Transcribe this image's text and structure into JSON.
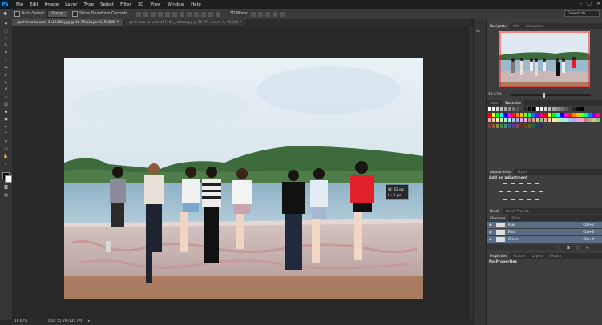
{
  "app": {
    "logo": "Ps"
  },
  "menu": [
    "File",
    "Edit",
    "Image",
    "Layer",
    "Type",
    "Select",
    "Filter",
    "3D",
    "View",
    "Window",
    "Help"
  ],
  "window_controls": [
    "–",
    "▢",
    "✕"
  ],
  "options": {
    "auto_select_label": "Auto-Select:",
    "auto_select_value": "Group",
    "transform_label": "Show Transform Controls",
    "mode_3d_label": "3D Mode:",
    "workspace": "Essentials"
  },
  "tabs": [
    {
      "label": "ganh-hoa-tu-xam-1116300.jpg @ 16.7% (Layer 3, RGB/8) *",
      "active": true
    },
    {
      "label": "ganh-hoa-tu-xam-481181_edited.jpg @ 16.7% (Layer 3, RGB/8) *",
      "active": false
    }
  ],
  "status": {
    "zoom": "16.67%",
    "doc": "Doc: 55.2M/135.7M"
  },
  "transform_readout": {
    "w": "W: 42 px",
    "h": "H: 6 px"
  },
  "navigator": {
    "tabs": [
      "Navigator",
      "Info",
      "Histogram"
    ],
    "zoom": "16.67%"
  },
  "color_panel": {
    "tabs": [
      "Color",
      "Swatches"
    ]
  },
  "adjustments": {
    "tabs": [
      "Adjustments",
      "Styles"
    ],
    "title": "Add an adjustment"
  },
  "brush_tabs": [
    "Brush",
    "Brush Presets"
  ],
  "channels": {
    "tabs": [
      "Channels",
      "Paths"
    ],
    "rows": [
      {
        "name": "RGB",
        "shortcut": "Ctrl+2"
      },
      {
        "name": "Red",
        "shortcut": "Ctrl+3"
      },
      {
        "name": "Green",
        "shortcut": "Ctrl+4"
      }
    ]
  },
  "properties": {
    "tabs": [
      "Properties",
      "Actions",
      "Layers",
      "History"
    ],
    "text": "No Properties"
  },
  "colors": {
    "accent": "#31a8ff",
    "selected_row": "#5a6e86",
    "panel": "#3d3d3d",
    "swatch_red": "#ff1a1a"
  }
}
